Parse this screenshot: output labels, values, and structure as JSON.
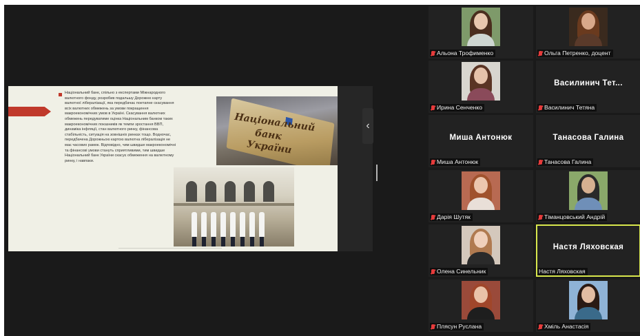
{
  "slide": {
    "text": "Національний банк, спільно з експертами Міжнародного валютного фонду, розробив подальшу Дорожню карту валютної лібералізації, яка передбачає поетапне скасування всіх валютних обмежень за умови покращення макроекономічних умов в Україні. Скасування валютних обмежень передуватиме оцінка Національним банком таких макроекономічних показників як темпи зростання ВВП, динаміка інфляції, стан валютного ринку, фінансова стабільність, ситуація на зовнішніх ринках тощо. Водночас, передбачена Дорожньою картою валютна лібералізація не має часових рамок. Відповідно, чим швидше макроекономічні та фінансові умови стануть сприятливими, тим швидше Національний банк України скасує обмеження на валютному ринку, і навпаки.",
    "sign_line_1": "Національний",
    "sign_line_2": "банк",
    "sign_line_3": "України"
  },
  "controls": {
    "collapse_glyph": "‹"
  },
  "participants": [
    {
      "name": "Альона Трофименко",
      "video": true,
      "muted": true,
      "photo": {
        "bg": "#7e9a6a",
        "skin": "#e8c7ae",
        "hair": "#4a2e1e",
        "body": "#cfd7d2"
      }
    },
    {
      "name": "Ольга Петренко, доцент",
      "video": true,
      "muted": true,
      "photo": {
        "bg": "#3a2a1e",
        "skin": "#d9a88a",
        "hair": "#6a3a1e",
        "body": "#5a3a2a"
      }
    },
    {
      "name": "Ирина Сенченко",
      "video": true,
      "muted": true,
      "photo": {
        "bg": "#d8d5cf",
        "skin": "#e6c2aa",
        "hair": "#5a3424",
        "body": "#8a4a5a"
      }
    },
    {
      "name": "Василинич Тетяна",
      "video": false,
      "display": "Василинич Тет...",
      "muted": true
    },
    {
      "name": "Миша Антонюк",
      "video": false,
      "display": "Миша Антонюк",
      "muted": true
    },
    {
      "name": "Танасова Галина",
      "video": false,
      "display": "Танасова Галина",
      "muted": true
    },
    {
      "name": "Дарія Шутяк",
      "video": true,
      "muted": true,
      "photo": {
        "bg": "#b86a52",
        "skin": "#ecc6ae",
        "hair": "#a0522d",
        "body": "#e9dfd8"
      }
    },
    {
      "name": "Тіманцовський Андрій",
      "video": true,
      "muted": true,
      "photo": {
        "bg": "#8aa86a",
        "skin": "#d6b091",
        "hair": "#2a2a2a",
        "body": "#6f8fb8"
      }
    },
    {
      "name": "Олена Синельник",
      "video": true,
      "muted": true,
      "photo": {
        "bg": "#d4c8bc",
        "skin": "#f0d0bb",
        "hair": "#b07a50",
        "body": "#2a2a2a"
      }
    },
    {
      "name": "Настя Ляховская",
      "video": false,
      "display": "Настя Ляховская",
      "muted": false,
      "active": true
    },
    {
      "name": "Плясун Руслана",
      "video": true,
      "muted": true,
      "photo": {
        "bg": "#9a4a3a",
        "skin": "#eac2a8",
        "hair": "#a0462a",
        "body": "#1e1e1e"
      }
    },
    {
      "name": "Хміль Анастасія",
      "video": true,
      "muted": true,
      "photo": {
        "bg": "#8fb3d6",
        "skin": "#e2bca2",
        "hair": "#2a1a14",
        "body": "#3a6a8a"
      }
    }
  ]
}
